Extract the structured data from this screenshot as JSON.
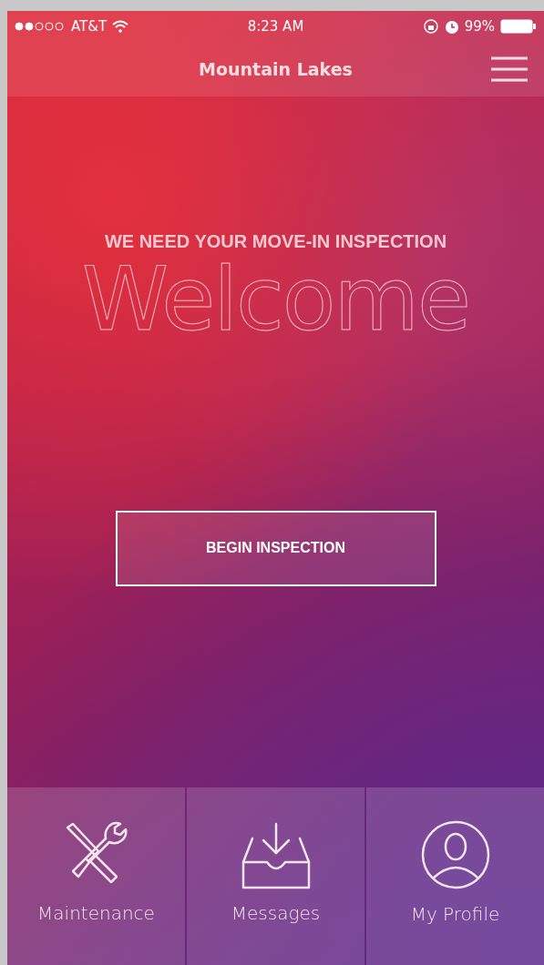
{
  "status_bar": {
    "carrier": "AT&T",
    "time": "8:23 AM",
    "battery": "99%"
  },
  "nav": {
    "title": "Mountain Lakes"
  },
  "hero": {
    "heading": "WE NEED YOUR MOVE-IN INSPECTION",
    "welcome": "Welcome",
    "button": "BEGIN INSPECTION"
  },
  "tabs": [
    {
      "kind": "tools",
      "label": "Maintenance"
    },
    {
      "kind": "inbox",
      "label": "Messages"
    },
    {
      "kind": "person",
      "label": "My Profile"
    }
  ]
}
